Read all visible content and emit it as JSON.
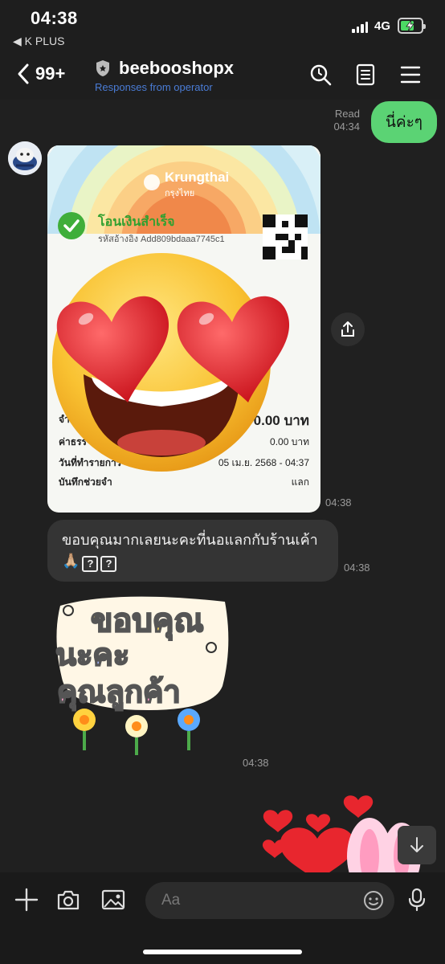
{
  "status_bar": {
    "time": "04:38",
    "back_app": "◀ K PLUS",
    "network": "4G"
  },
  "header": {
    "back_count": "99+",
    "title": "beebooshopx",
    "subtitle": "Responses from operator"
  },
  "messages": {
    "outgoing_1": {
      "text": "นี่ค่ะๆ",
      "read_label": "Read",
      "time": "04:34"
    },
    "receipt": {
      "bank": "Krungthai",
      "bank_th": "กรุงไทย",
      "status": "โอนเงินสำเร็จ",
      "ref": "รหัสอ้างอิง Add809bdaaa7745c1",
      "rows": [
        {
          "label": "จำ",
          "value": "0.00 บาท"
        },
        {
          "label": "ค่าธรร",
          "value": "0.00 บาท"
        },
        {
          "label": "วันที่ทำรายการ",
          "value": "05 เม.ย. 2568 - 04:37"
        },
        {
          "label": "บันทึกช่วยจำ",
          "value": "แลก"
        }
      ],
      "time": "04:38"
    },
    "incoming_text": {
      "text": "ขอบคุณมากเลยนะคะที่นอแลกกับร้านเค้า🙏🏼",
      "q1": "?",
      "q2": "?",
      "time": "04:38"
    },
    "sticker": {
      "line1": "ขอบคุณ",
      "line2": "นะคะ",
      "line3": "คุณลูกค้า",
      "time": "04:38"
    }
  },
  "input": {
    "placeholder": "Aa"
  },
  "colors": {
    "accent_green": "#5bd374",
    "subtitle_blue": "#4a7cd6",
    "bg": "#202020"
  }
}
